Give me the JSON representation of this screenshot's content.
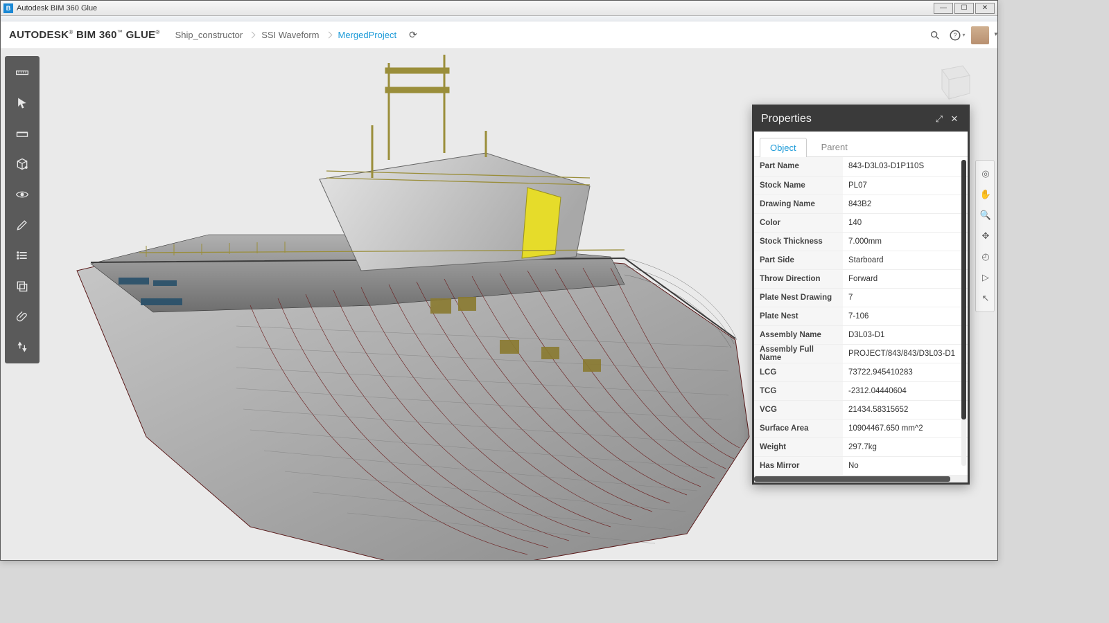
{
  "window": {
    "title": "Autodesk BIM 360 Glue"
  },
  "brand": {
    "name_prefix": "AUTODESK",
    "name_main": "BIM 360",
    "name_suffix": "GLUE"
  },
  "breadcrumb": {
    "items": [
      "Ship_constructor",
      "SSI Waveform",
      "MergedProject"
    ],
    "active_index": 2
  },
  "header_icons": {
    "search": "search-icon",
    "help": "help-icon"
  },
  "left_toolbar": [
    "ruler-icon",
    "cursor-icon",
    "section-icon",
    "cube-icon",
    "eye-icon",
    "pen-icon",
    "list-icon",
    "layers-icon",
    "attach-icon",
    "sync-icon"
  ],
  "right_toolbar": [
    "orbit-icon",
    "pan-icon",
    "zoom-icon",
    "free-orbit-icon",
    "look-icon",
    "fly-icon",
    "select-icon"
  ],
  "properties": {
    "title": "Properties",
    "tabs": [
      "Object",
      "Parent"
    ],
    "active_tab": 0,
    "rows": [
      {
        "k": "Part Name",
        "v": "843-D3L03-D1P110S"
      },
      {
        "k": "Stock Name",
        "v": "PL07"
      },
      {
        "k": "Drawing Name",
        "v": "843B2"
      },
      {
        "k": "Color",
        "v": "140"
      },
      {
        "k": "Stock Thickness",
        "v": "7.000mm"
      },
      {
        "k": "Part Side",
        "v": "Starboard"
      },
      {
        "k": "Throw Direction",
        "v": "Forward"
      },
      {
        "k": "Plate Nest Drawing",
        "v": "7"
      },
      {
        "k": "Plate Nest",
        "v": "7-106"
      },
      {
        "k": "Assembly Name",
        "v": "D3L03-D1"
      },
      {
        "k": "Assembly Full Name",
        "v": "PROJECT/843/843/D3L03-D1"
      },
      {
        "k": "LCG",
        "v": "73722.945410283"
      },
      {
        "k": "TCG",
        "v": "-2312.04440604"
      },
      {
        "k": "VCG",
        "v": "21434.58315652"
      },
      {
        "k": "Surface Area",
        "v": "10904467.650 mm^2"
      },
      {
        "k": "Weight",
        "v": "297.7kg"
      },
      {
        "k": "Has Mirror",
        "v": "No"
      }
    ]
  }
}
